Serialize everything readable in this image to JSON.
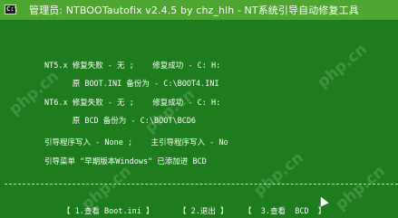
{
  "window": {
    "title": "管理员:  NTBOOTautofix v2.4.5 by chz_hlh - NT系统引导自动修复工具",
    "icon_glyph": "C:\\",
    "icon": "console-icon"
  },
  "console": {
    "lines": [
      "NT5.x 修复失败 - 无 ;    修复成功 - C: H:",
      "      原 BOOT.INI 备份为 - C:\\BOOT4.INI",
      "NT6.x 修复失败 - 无 ;    修复成功 - C: H:",
      "      原 BCD 备份为 - C:\\BOOT\\BCD6",
      "引导程序写入 - None ;    主引导程序写入 - No",
      "引导菜单 \"早期版本Windows\" 已添加进 BCD"
    ],
    "separator": "------------------------------------------------------------------------"
  },
  "menu": {
    "items": [
      "【 1.查看 Boot.ini 】",
      "【 2.退出 】",
      "【  3.查看  BCD  】"
    ]
  },
  "watermark": "php.cn",
  "colors": {
    "titlebar": "#4fa532",
    "console_bg": "#1e7c1e",
    "text": "#ffffff"
  }
}
